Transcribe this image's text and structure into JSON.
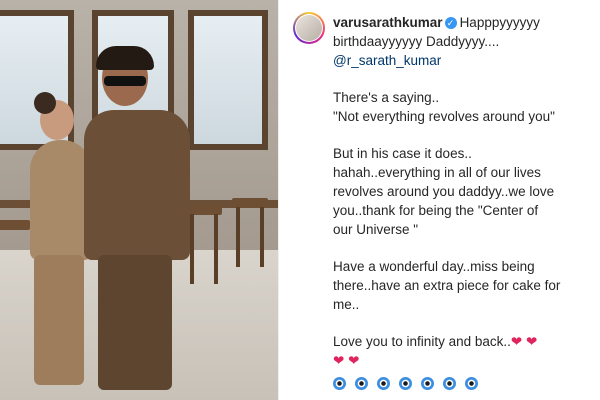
{
  "post": {
    "username": "varusarathkumar",
    "verified": true,
    "caption_line1": "Happpyyyyyy",
    "caption_line2": "birthdaayyyyyy Daddyyyy....",
    "mention": "@r_sarath_kumar",
    "para1": [
      "There's a saying..",
      "\"Not everything revolves around you\""
    ],
    "para2": [
      "But in his case it does..",
      "hahah..everything in all of our lives",
      "revolves around you daddyy..we love",
      "you..thank for being the \"Center of",
      "our Universe \""
    ],
    "para3": [
      "Have a wonderful day..miss being",
      "there..have an extra piece for cake for",
      "me.."
    ],
    "closing": "Love you to infinity and back..",
    "emoji_icons": [
      "red-heart",
      "red-heart",
      "red-heart",
      "red-heart",
      "nazar-amulet",
      "nazar-amulet",
      "nazar-amulet",
      "nazar-amulet",
      "nazar-amulet",
      "nazar-amulet",
      "nazar-amulet"
    ],
    "colors": {
      "heart": "#e0245e",
      "verified": "#3897f0",
      "mention": "#00376b"
    }
  }
}
